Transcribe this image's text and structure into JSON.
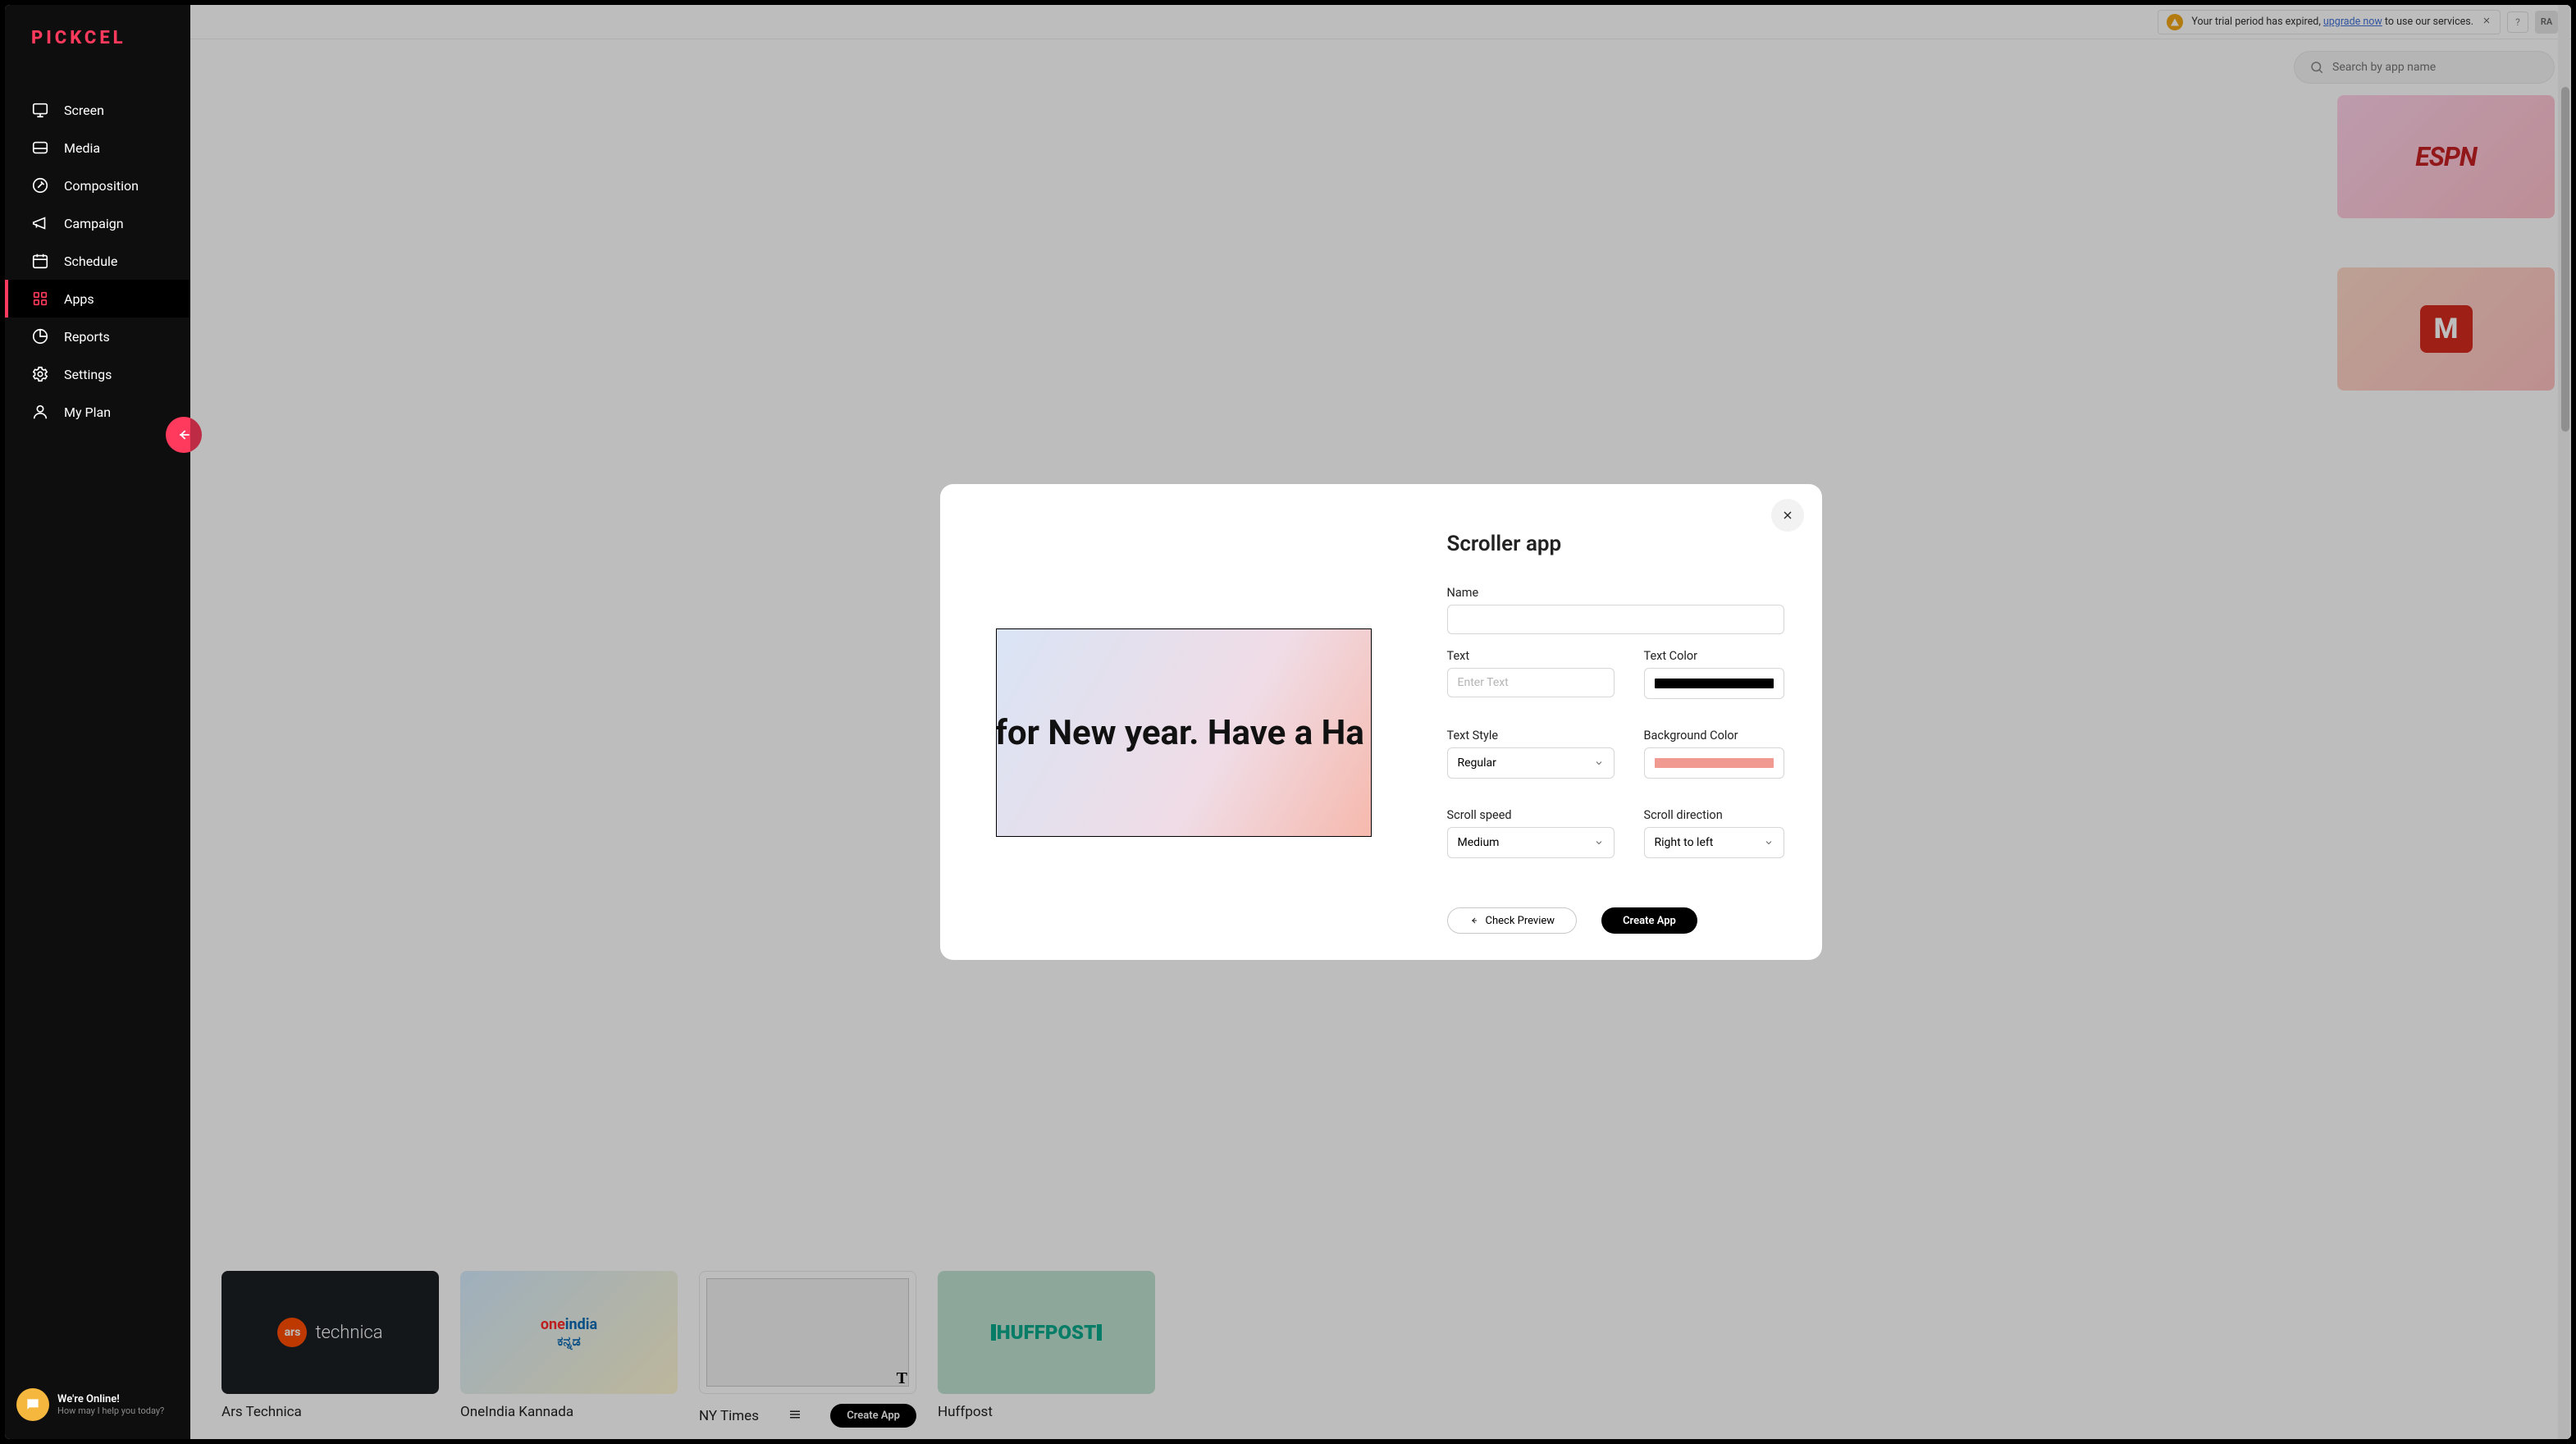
{
  "brand": "PICKCEL",
  "sidebar": {
    "items": [
      {
        "label": "Screen"
      },
      {
        "label": "Media"
      },
      {
        "label": "Composition"
      },
      {
        "label": "Campaign"
      },
      {
        "label": "Schedule"
      },
      {
        "label": "Apps"
      },
      {
        "label": "Reports"
      },
      {
        "label": "Settings"
      },
      {
        "label": "My Plan"
      }
    ]
  },
  "online": {
    "title": "We're Online!",
    "sub": "How may I help you today?"
  },
  "topbar": {
    "trial_prefix": "Your trial period has expired, ",
    "trial_link": "upgrade now",
    "trial_suffix": " to use our services.",
    "help": "?",
    "avatar": "RA"
  },
  "search": {
    "placeholder": "Search by app name"
  },
  "cards": {
    "espn": "ESPN",
    "m": "M",
    "ars_dot": "ars",
    "ars_text": "technica",
    "ars_label": "Ars Technica",
    "one_top_one": "one",
    "one_top_india": "india",
    "one_bot": "ಕನ್ನಡ",
    "one_label": "OneIndia Kannada",
    "ny_t": "T",
    "ny_label": "NY Times",
    "create_app": "Create App",
    "huff_text": "HUFFPOST",
    "huff_label": "Huffpost"
  },
  "modal": {
    "title": "Scroller app",
    "preview_text": "sed for New year. Have a Ha",
    "labels": {
      "name": "Name",
      "text": "Text",
      "text_color": "Text Color",
      "text_style": "Text Style",
      "bg_color": "Background Color",
      "speed": "Scroll speed",
      "direction": "Scroll direction"
    },
    "values": {
      "name": "",
      "text_placeholder": "Enter Text",
      "text_color": "#000000",
      "text_style": "Regular",
      "bg_color": "#f19a91",
      "speed": "Medium",
      "direction": "Right to left"
    },
    "actions": {
      "preview": "Check Preview",
      "create": "Create App"
    }
  }
}
